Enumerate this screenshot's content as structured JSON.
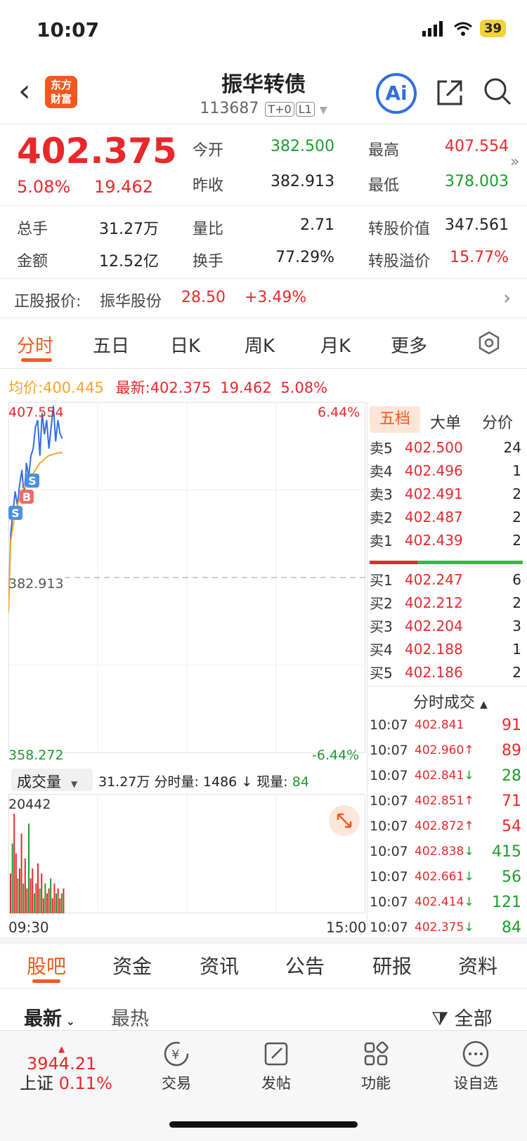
{
  "status": {
    "time": "10:07",
    "battery": "39"
  },
  "header": {
    "title": "振华转债",
    "code": "113687",
    "tag1": "T+0",
    "tag2": "L1",
    "logo_line1": "东方",
    "logo_line2": "财富",
    "ai_label": "Ai"
  },
  "quote": {
    "price": "402.375",
    "pct": "5.08%",
    "change": "19.462",
    "open_label": "今开",
    "open": "382.500",
    "high_label": "最高",
    "high": "407.554",
    "prev_label": "昨收",
    "prev": "382.913",
    "low_label": "最低",
    "low": "378.003",
    "vol_label": "总手",
    "vol": "31.27万",
    "ratio_label": "量比",
    "ratio": "2.71",
    "conv_value_label": "转股价值",
    "conv_value": "347.561",
    "amount_label": "金额",
    "amount": "12.52亿",
    "turnover_label": "换手",
    "turnover": "77.29%",
    "premium_label": "转股溢价",
    "premium": "15.77%"
  },
  "underlying": {
    "label": "正股报价:",
    "name": "振华股份",
    "price": "28.50",
    "pct": "+3.49%"
  },
  "chart_tabs": [
    "分时",
    "五日",
    "日K",
    "周K",
    "月K",
    "更多"
  ],
  "chart_info": {
    "avg_label": "均价:",
    "avg": "400.445",
    "latest_label": "最新:",
    "latest": "402.375",
    "change": "19.462",
    "pct": "5.08%"
  },
  "chart_data": {
    "type": "line",
    "ylim": [
      358.272,
      407.554
    ],
    "y_top_label": "407.554",
    "y_mid_label": "382.913",
    "y_bottom_label": "358.272",
    "pct_top": "6.44%",
    "pct_bottom": "-6.44%",
    "x_start": "09:30",
    "x_end": "15:00",
    "series": [
      {
        "values": [
          378,
          389,
          392,
          395,
          393,
          396,
          398,
          394,
          399,
          397,
          400,
          401,
          404,
          405,
          400,
          406,
          403,
          405,
          401,
          404,
          407,
          402,
          405,
          403,
          402.4
        ]
      },
      {
        "values": [
          378,
          388,
          390,
          392,
          393,
          394,
          395,
          395.5,
          396,
          396.5,
          397,
          397.5,
          398,
          398.5,
          399,
          399.2,
          399.5,
          399.8,
          400,
          400.1,
          400.2,
          400.3,
          400.4,
          400.4,
          400.445
        ]
      }
    ],
    "markers": [
      "S",
      "B",
      "S"
    ],
    "volume": {
      "label": "成交量",
      "total": "31.27万",
      "minute_label": "分时量:",
      "minute": "1486",
      "current_label": "现量:",
      "current": "84",
      "max_label": "20442",
      "bars": [
        8,
        14,
        20,
        12,
        7,
        9,
        16,
        6,
        11,
        5,
        18,
        7,
        9,
        4,
        6,
        10,
        5,
        8,
        3,
        6,
        4,
        5,
        7,
        3,
        6,
        4,
        5,
        3,
        4,
        5
      ]
    }
  },
  "order_book": {
    "tabs": [
      "五档",
      "大单",
      "分价"
    ],
    "asks": [
      {
        "label": "卖5",
        "price": "402.500",
        "qty": "24"
      },
      {
        "label": "卖4",
        "price": "402.496",
        "qty": "1"
      },
      {
        "label": "卖3",
        "price": "402.491",
        "qty": "2"
      },
      {
        "label": "卖2",
        "price": "402.487",
        "qty": "2"
      },
      {
        "label": "卖1",
        "price": "402.439",
        "qty": "2"
      }
    ],
    "bids": [
      {
        "label": "买1",
        "price": "402.247",
        "qty": "6"
      },
      {
        "label": "买2",
        "price": "402.212",
        "qty": "2"
      },
      {
        "label": "买3",
        "price": "402.204",
        "qty": "3"
      },
      {
        "label": "买4",
        "price": "402.188",
        "qty": "1"
      },
      {
        "label": "买5",
        "price": "402.186",
        "qty": "2"
      }
    ]
  },
  "trades": {
    "title": "分时成交",
    "rows": [
      {
        "time": "10:07",
        "price": "402.841",
        "dir": "",
        "qty": "91",
        "color": "red"
      },
      {
        "time": "10:07",
        "price": "402.960",
        "dir": "↑",
        "qty": "89",
        "color": "red"
      },
      {
        "time": "10:07",
        "price": "402.841",
        "dir": "↓",
        "qty": "28",
        "color": "green"
      },
      {
        "time": "10:07",
        "price": "402.851",
        "dir": "↑",
        "qty": "71",
        "color": "red"
      },
      {
        "time": "10:07",
        "price": "402.872",
        "dir": "↑",
        "qty": "54",
        "color": "red"
      },
      {
        "time": "10:07",
        "price": "402.838",
        "dir": "↓",
        "qty": "415",
        "color": "green"
      },
      {
        "time": "10:07",
        "price": "402.661",
        "dir": "↓",
        "qty": "56",
        "color": "green"
      },
      {
        "time": "10:07",
        "price": "402.414",
        "dir": "↓",
        "qty": "121",
        "color": "green"
      },
      {
        "time": "10:07",
        "price": "402.375",
        "dir": "↓",
        "qty": "84",
        "color": "green"
      }
    ]
  },
  "bottom_tabs": [
    "股吧",
    "资金",
    "资讯",
    "公告",
    "研报",
    "资料"
  ],
  "feed": {
    "sort1": "最新",
    "sort2": "最热",
    "filter": "全部"
  },
  "dock": {
    "index_value": "3944.21",
    "index_name": "上证",
    "index_pct": "0.11%",
    "items": [
      "交易",
      "发帖",
      "功能",
      "设自选"
    ]
  }
}
